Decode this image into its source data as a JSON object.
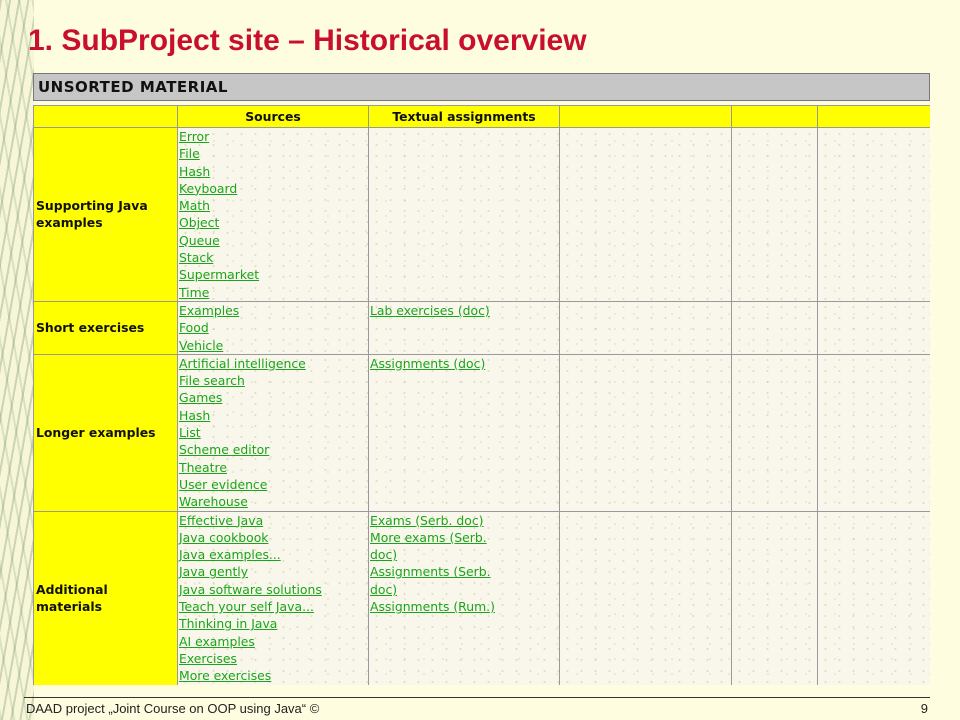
{
  "title": "1. SubProject site – Historical overview",
  "section_header": "UNSORTED MATERIAL",
  "columns": [
    "",
    "Sources",
    "Textual assignments",
    "",
    "",
    ""
  ],
  "rows": [
    {
      "label": "Supporting Java examples",
      "sources": [
        "Error",
        "File",
        "Hash",
        "Keyboard",
        "Math",
        "Object",
        "Queue",
        "Stack",
        "Supermarket",
        "Time"
      ],
      "assignments": []
    },
    {
      "label": "Short exercises",
      "sources": [
        "Examples",
        "Food",
        "Vehicle"
      ],
      "assignments": [
        "Lab exercises (doc)"
      ]
    },
    {
      "label": "Longer examples",
      "sources": [
        "Artificial intelligence",
        "File search",
        "Games",
        "Hash",
        "List",
        "Scheme editor",
        "Theatre",
        "User evidence",
        "Warehouse"
      ],
      "assignments": [
        "Assignments (doc)"
      ]
    },
    {
      "label": "Additional materials",
      "sources": [
        "Effective Java",
        "Java cookbook",
        "Java examples...",
        "Java gently",
        "Java software solutions",
        "Teach your self Java...",
        "Thinking in Java",
        "AI examples",
        "Exercises",
        "More exercises"
      ],
      "assignments": [
        "Exams (Serb. doc)",
        "More exams (Serb.",
        "doc)",
        "Assignments (Serb.",
        "doc)",
        "Assignments (Rum.)"
      ]
    }
  ],
  "footer": "DAAD project „Joint Course on OOP using Java“ ©",
  "page_number": "9",
  "colors": {
    "title": "#c8102e",
    "link": "#1aa51a",
    "highlight": "#ffff00",
    "header_bar": "#c6c6c6"
  }
}
